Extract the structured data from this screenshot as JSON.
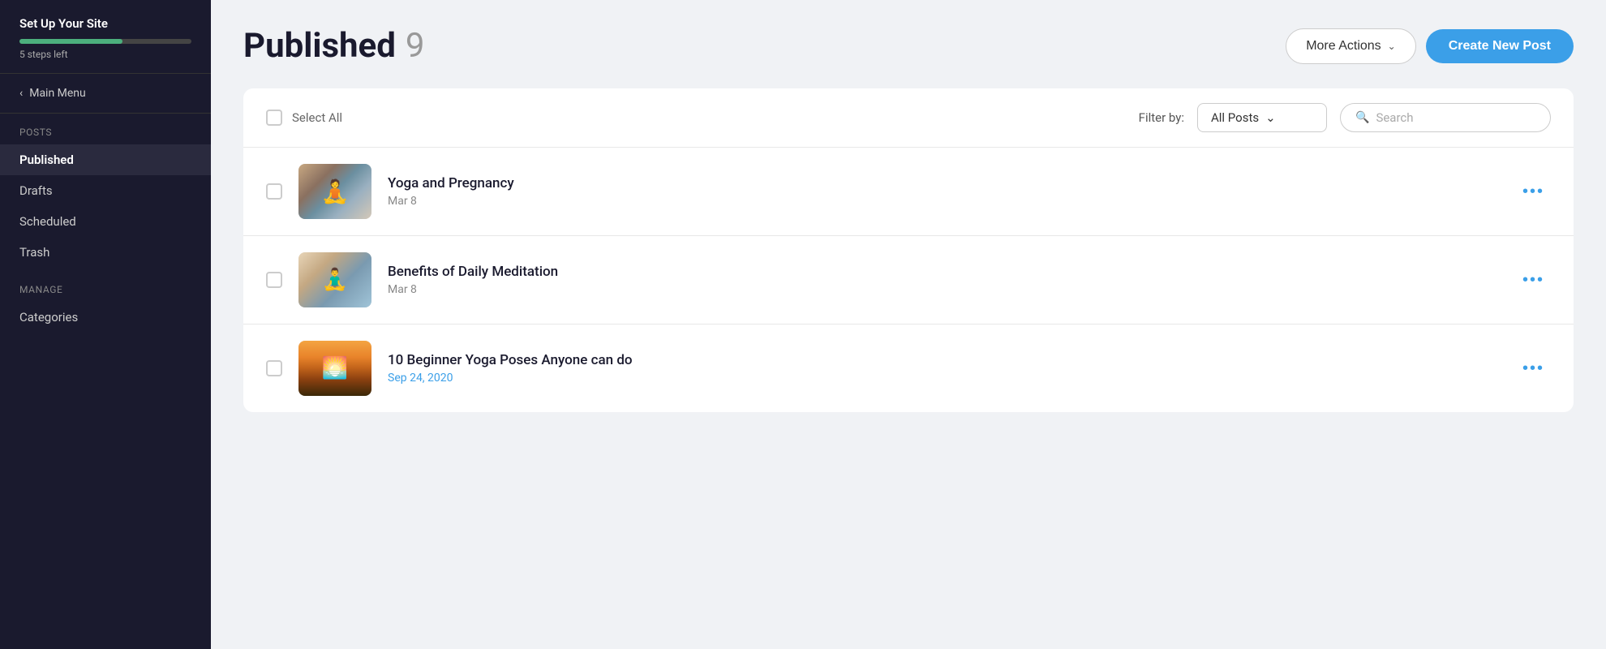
{
  "sidebar": {
    "setup_title": "Set Up Your Site",
    "steps_left": "5 steps left",
    "main_menu_label": "Main Menu",
    "sections": {
      "posts_label": "Posts",
      "manage_label": "Manage"
    },
    "nav_items": [
      {
        "id": "published",
        "label": "Published",
        "active": true
      },
      {
        "id": "drafts",
        "label": "Drafts",
        "active": false
      },
      {
        "id": "scheduled",
        "label": "Scheduled",
        "active": false
      },
      {
        "id": "trash",
        "label": "Trash",
        "active": false
      }
    ],
    "manage_items": [
      {
        "id": "categories",
        "label": "Categories"
      }
    ]
  },
  "header": {
    "title": "Published",
    "count": "9",
    "more_actions_label": "More Actions",
    "create_new_post_label": "Create New Post"
  },
  "filter_bar": {
    "select_all_label": "Select All",
    "filter_by_label": "Filter by:",
    "filter_select_value": "All Posts",
    "search_placeholder": "Search"
  },
  "posts": [
    {
      "id": "post-1",
      "title": "Yoga and Pregnancy",
      "date": "Mar 8",
      "date_accent": false,
      "thumb_class": "thumb-yoga-pregnancy"
    },
    {
      "id": "post-2",
      "title": "Benefits of Daily Meditation",
      "date": "Mar 8",
      "date_accent": false,
      "thumb_class": "thumb-meditation"
    },
    {
      "id": "post-3",
      "title": "10 Beginner Yoga Poses Anyone can do",
      "date": "Sep 24, 2020",
      "date_accent": true,
      "thumb_class": "thumb-beginner-yoga"
    }
  ],
  "icons": {
    "back_arrow": "‹",
    "chevron_down": "⌄",
    "search": "🔍",
    "ellipsis": "•••"
  }
}
